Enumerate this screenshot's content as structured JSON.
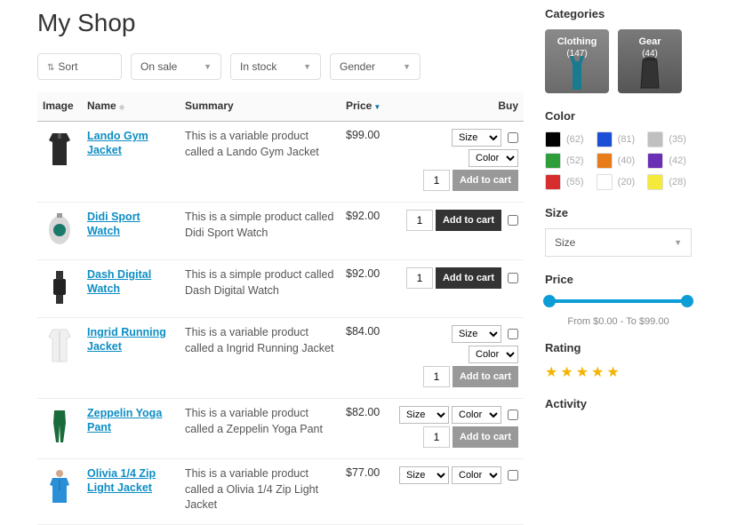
{
  "title": "My Shop",
  "filters": {
    "sort": "Sort",
    "onsale": "On sale",
    "instock": "In stock",
    "gender": "Gender"
  },
  "headers": {
    "image": "Image",
    "name": "Name",
    "summary": "Summary",
    "price": "Price",
    "buy": "Buy"
  },
  "products": [
    {
      "name": "Lando Gym Jacket",
      "summary": "This is a variable product called a Lando Gym Jacket",
      "price": "$99.00",
      "variable": true
    },
    {
      "name": "Didi Sport Watch",
      "summary": "This is a simple product called Didi Sport Watch",
      "price": "$92.00",
      "variable": false
    },
    {
      "name": "Dash Digital Watch",
      "summary": "This is a simple product called Dash Digital Watch",
      "price": "$92.00",
      "variable": false
    },
    {
      "name": "Ingrid Running Jacket",
      "summary": "This is a variable product called a Ingrid Running Jacket",
      "price": "$84.00",
      "variable": true
    },
    {
      "name": "Zeppelin Yoga Pant",
      "summary": "This is a variable product called a Zeppelin Yoga Pant",
      "price": "$82.00",
      "variable": true
    },
    {
      "name": "Olivia 1/4 Zip Light Jacket",
      "summary": "This is a variable product called a Olivia 1/4 Zip Light Jacket",
      "price": "$77.00",
      "variable": true
    }
  ],
  "buy": {
    "size": "Size",
    "color": "Color",
    "qty": "1",
    "add": "Add to cart"
  },
  "side": {
    "categories_h": "Categories",
    "cats": [
      {
        "label": "Clothing",
        "count": "(147)"
      },
      {
        "label": "Gear",
        "count": "(44)"
      }
    ],
    "color_h": "Color",
    "colors": [
      {
        "hex": "#000000",
        "count": "(62)"
      },
      {
        "hex": "#1a4fd6",
        "count": "(81)"
      },
      {
        "hex": "#bfbfbf",
        "count": "(35)"
      },
      {
        "hex": "#2e9e3b",
        "count": "(52)"
      },
      {
        "hex": "#e87b1a",
        "count": "(40)"
      },
      {
        "hex": "#6a2fb5",
        "count": "(42)"
      },
      {
        "hex": "#d62e2e",
        "count": "(55)"
      },
      {
        "hex": "#ffffff",
        "count": "(20)"
      },
      {
        "hex": "#f5e93a",
        "count": "(28)"
      }
    ],
    "size_h": "Size",
    "size_sel": "Size",
    "price_h": "Price",
    "price_range": "From $0.00 - To $99.00",
    "rating_h": "Rating",
    "activity_h": "Activity"
  }
}
